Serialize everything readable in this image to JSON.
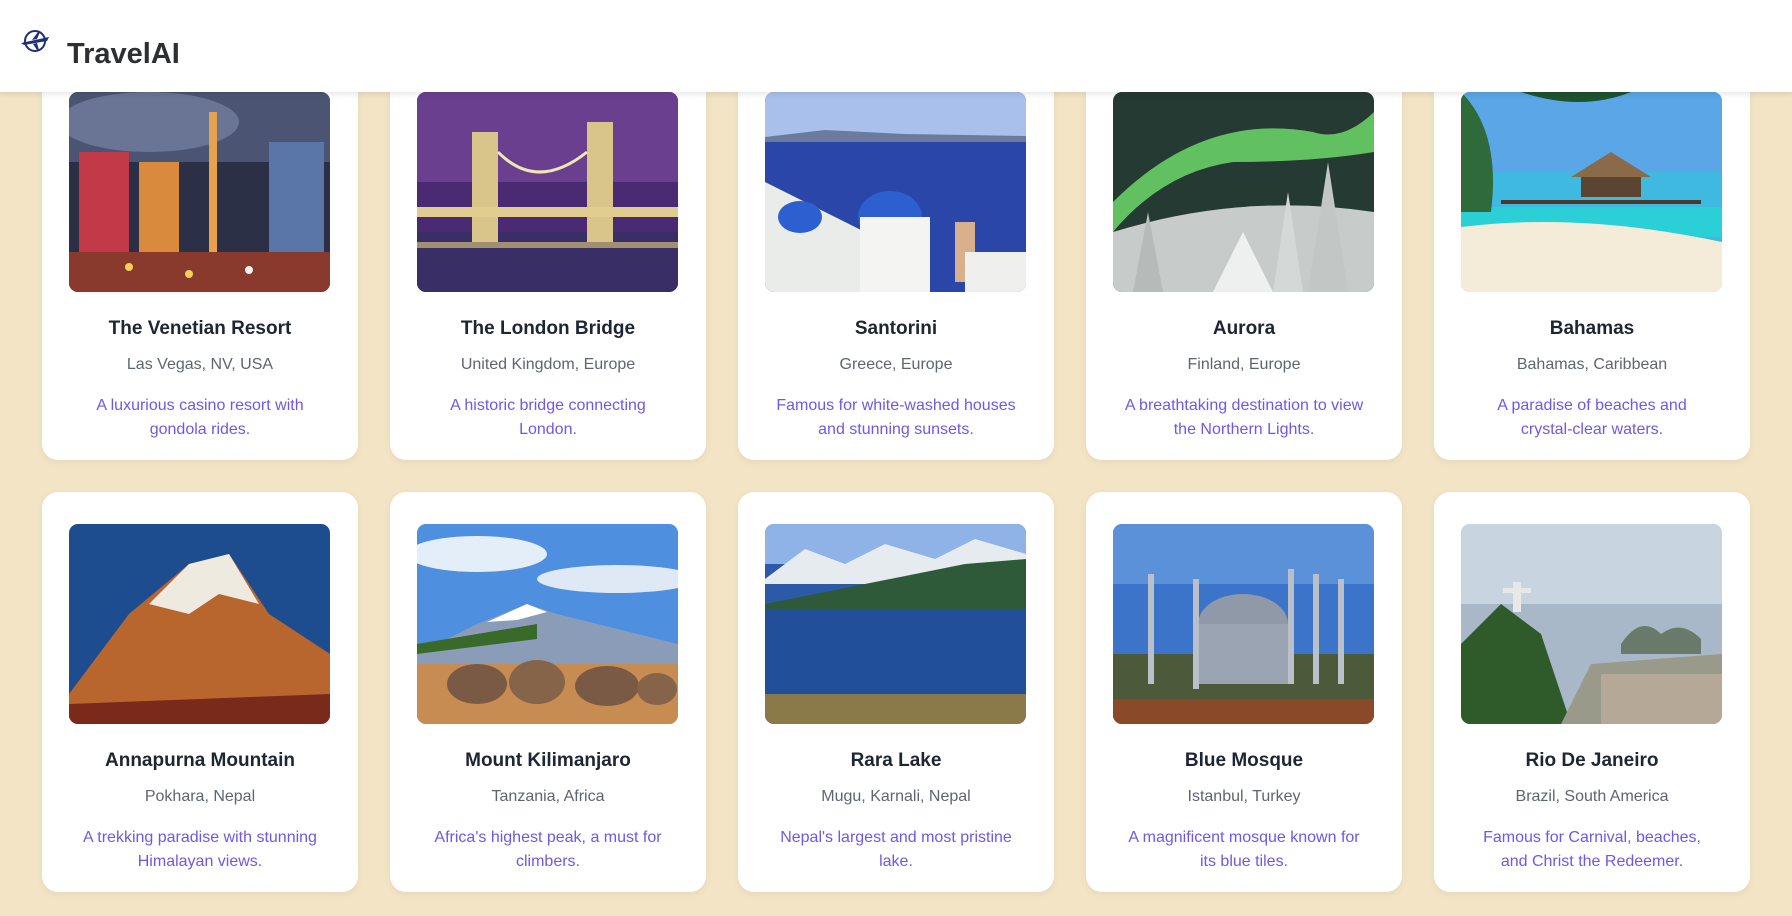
{
  "header": {
    "brand": "TravelAI",
    "logo_icon": "airplane-globe-icon"
  },
  "destinations": [
    {
      "name": "The Venetian Resort",
      "location": "Las Vegas, NV, USA",
      "description": "A luxurious casino resort with gondola rides.",
      "image": "las-vegas-strip-night"
    },
    {
      "name": "The London Bridge",
      "location": "United Kingdom, Europe",
      "description": "A historic bridge connecting London.",
      "image": "tower-bridge-night"
    },
    {
      "name": "Santorini",
      "location": "Greece, Europe",
      "description": "Famous for white-washed houses and stunning sunsets.",
      "image": "santorini-blue-domes"
    },
    {
      "name": "Aurora",
      "location": "Finland, Europe",
      "description": "A breathtaking destination to view the Northern Lights.",
      "image": "northern-lights-snowy-forest"
    },
    {
      "name": "Bahamas",
      "location": "Bahamas, Caribbean",
      "description": "A paradise of beaches and crystal-clear waters.",
      "image": "tropical-beach-hut"
    },
    {
      "name": "Annapurna Mountain",
      "location": "Pokhara, Nepal",
      "description": "A trekking paradise with stunning Himalayan views.",
      "image": "snow-peak-sunset"
    },
    {
      "name": "Mount Kilimanjaro",
      "location": "Tanzania, Africa",
      "description": "Africa's highest peak, a must for climbers.",
      "image": "elephants-kilimanjaro"
    },
    {
      "name": "Rara Lake",
      "location": "Mugu, Karnali, Nepal",
      "description": "Nepal's largest and most pristine lake.",
      "image": "mountain-lake"
    },
    {
      "name": "Blue Mosque",
      "location": "Istanbul, Turkey",
      "description": "A magnificent mosque known for its blue tiles.",
      "image": "mosque-minarets"
    },
    {
      "name": "Rio De Janeiro",
      "location": "Brazil, South America",
      "description": "Famous for Carnival, beaches, and Christ the Redeemer.",
      "image": "christ-redeemer-city"
    }
  ],
  "colors": {
    "page_background": "#f3e4c6",
    "card_background": "#ffffff",
    "title_text": "#1e2533",
    "location_text": "#5f6570",
    "description_text": "#7356e8"
  }
}
